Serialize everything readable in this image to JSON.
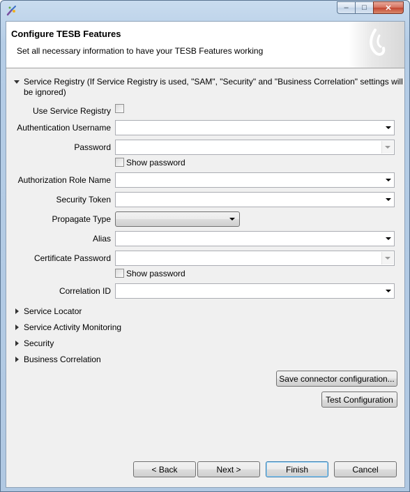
{
  "header": {
    "title": "Configure TESB Features",
    "description": "Set all necessary information to have your TESB Features working"
  },
  "service_registry": {
    "section_line1": "Service Registry (If Service Registry is used, \"SAM\", \"Security\" and \"Business Correlation\" settings will",
    "section_line2": "be ignored)",
    "use_label": "Use Service Registry",
    "auth_username_label": "Authentication Username",
    "password_label": "Password",
    "show_password_label": "Show password",
    "auth_role_label": "Authorization Role Name",
    "security_token_label": "Security Token",
    "propagate_type_label": "Propagate Type",
    "alias_label": "Alias",
    "cert_password_label": "Certificate Password",
    "show_password2_label": "Show password",
    "correlation_id_label": "Correlation ID"
  },
  "sections": {
    "service_locator": "Service Locator",
    "sam": "Service Activity Monitoring",
    "security": "Security",
    "business_correlation": "Business Correlation"
  },
  "actions": {
    "save_connector": "Save connector configuration...",
    "test_config": "Test Configuration"
  },
  "footer": {
    "back": "< Back",
    "next": "Next >",
    "finish": "Finish",
    "cancel": "Cancel"
  },
  "window_buttons": {
    "minimize": "–",
    "maximize": "□",
    "close": "✕"
  }
}
